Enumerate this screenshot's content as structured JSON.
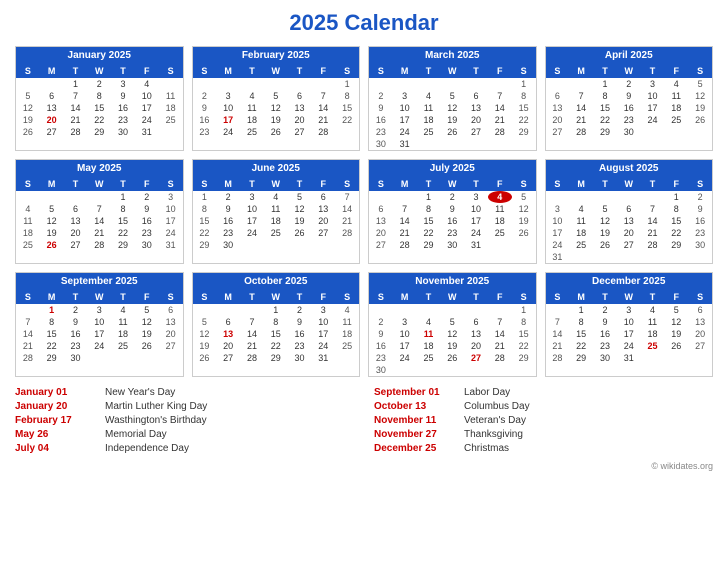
{
  "title": "2025 Calendar",
  "months": [
    {
      "name": "January 2025",
      "weeks": [
        [
          "",
          "",
          "1",
          "2",
          "3",
          "4",
          ""
        ],
        [
          "5",
          "6",
          "7",
          "8",
          "9",
          "10",
          "11"
        ],
        [
          "12",
          "13",
          "14",
          "15",
          "16",
          "17",
          "18"
        ],
        [
          "19",
          "20h",
          "21",
          "22",
          "23",
          "24",
          "25"
        ],
        [
          "26",
          "27",
          "28",
          "29",
          "30",
          "31",
          ""
        ]
      ]
    },
    {
      "name": "February 2025",
      "weeks": [
        [
          "",
          "",
          "",
          "",
          "",
          "",
          "1"
        ],
        [
          "2",
          "3",
          "4",
          "5",
          "6",
          "7",
          "8"
        ],
        [
          "9",
          "10",
          "11",
          "12",
          "13",
          "14",
          "15"
        ],
        [
          "16",
          "17h",
          "18",
          "19",
          "20",
          "21",
          "22"
        ],
        [
          "23",
          "24",
          "25",
          "26",
          "27",
          "28",
          ""
        ]
      ]
    },
    {
      "name": "March 2025",
      "weeks": [
        [
          "",
          "",
          "",
          "",
          "",
          "",
          "1"
        ],
        [
          "2",
          "3",
          "4",
          "5",
          "6",
          "7",
          "8"
        ],
        [
          "9",
          "10",
          "11",
          "12",
          "13",
          "14",
          "15"
        ],
        [
          "16",
          "17",
          "18",
          "19",
          "20",
          "21",
          "22"
        ],
        [
          "23",
          "24",
          "25",
          "26",
          "27",
          "28",
          "29"
        ],
        [
          "30",
          "31",
          "",
          "",
          "",
          "",
          ""
        ]
      ]
    },
    {
      "name": "April 2025",
      "weeks": [
        [
          "",
          "",
          "1",
          "2",
          "3",
          "4",
          "5"
        ],
        [
          "6",
          "7",
          "8",
          "9",
          "10",
          "11",
          "12"
        ],
        [
          "13",
          "14",
          "15",
          "16",
          "17",
          "18",
          "19"
        ],
        [
          "20",
          "21",
          "22",
          "23",
          "24",
          "25",
          "26"
        ],
        [
          "27",
          "28",
          "29",
          "30",
          "",
          "",
          ""
        ]
      ]
    },
    {
      "name": "May 2025",
      "weeks": [
        [
          "",
          "",
          "",
          "",
          "1",
          "2",
          "3"
        ],
        [
          "4",
          "5",
          "6",
          "7",
          "8",
          "9",
          "10"
        ],
        [
          "11",
          "12",
          "13",
          "14",
          "15",
          "16",
          "17"
        ],
        [
          "18",
          "19",
          "20",
          "21",
          "22",
          "23",
          "24"
        ],
        [
          "25",
          "26h",
          "27",
          "28",
          "29",
          "30",
          "31"
        ]
      ]
    },
    {
      "name": "June 2025",
      "weeks": [
        [
          "1",
          "2",
          "3",
          "4",
          "5",
          "6",
          "7"
        ],
        [
          "8",
          "9",
          "10",
          "11",
          "12",
          "13",
          "14"
        ],
        [
          "15",
          "16",
          "17",
          "18",
          "19",
          "20",
          "21"
        ],
        [
          "22",
          "23",
          "24",
          "25",
          "26",
          "27",
          "28"
        ],
        [
          "29",
          "30",
          "",
          "",
          "",
          "",
          ""
        ]
      ]
    },
    {
      "name": "July 2025",
      "weeks": [
        [
          "",
          "",
          "1",
          "2",
          "3",
          "4r",
          "5"
        ],
        [
          "6",
          "7",
          "8",
          "9",
          "10",
          "11",
          "12"
        ],
        [
          "13",
          "14",
          "15",
          "16",
          "17",
          "18",
          "19"
        ],
        [
          "20",
          "21",
          "22",
          "23",
          "24",
          "25",
          "26"
        ],
        [
          "27",
          "28",
          "29",
          "30",
          "31",
          "",
          ""
        ]
      ]
    },
    {
      "name": "August 2025",
      "weeks": [
        [
          "",
          "",
          "",
          "",
          "",
          "1",
          "2"
        ],
        [
          "3",
          "4",
          "5",
          "6",
          "7",
          "8",
          "9"
        ],
        [
          "10",
          "11",
          "12",
          "13",
          "14",
          "15",
          "16"
        ],
        [
          "17",
          "18",
          "19",
          "20",
          "21",
          "22",
          "23"
        ],
        [
          "24",
          "25",
          "26",
          "27",
          "28",
          "29",
          "30"
        ],
        [
          "31",
          "",
          "",
          "",
          "",
          "",
          ""
        ]
      ]
    },
    {
      "name": "September 2025",
      "weeks": [
        [
          "",
          "1h",
          "2",
          "3",
          "4",
          "5",
          "6"
        ],
        [
          "7",
          "8",
          "9",
          "10",
          "11",
          "12",
          "13"
        ],
        [
          "14",
          "15",
          "16",
          "17",
          "18",
          "19",
          "20"
        ],
        [
          "21",
          "22",
          "23",
          "24",
          "25",
          "26",
          "27"
        ],
        [
          "28",
          "29",
          "30",
          "",
          "",
          "",
          ""
        ]
      ]
    },
    {
      "name": "October 2025",
      "weeks": [
        [
          "",
          "",
          "",
          "1",
          "2",
          "3",
          "4"
        ],
        [
          "5",
          "6",
          "7",
          "8",
          "9",
          "10",
          "11"
        ],
        [
          "12",
          "13h",
          "14",
          "15",
          "16",
          "17",
          "18"
        ],
        [
          "19",
          "20",
          "21",
          "22",
          "23",
          "24",
          "25"
        ],
        [
          "26",
          "27",
          "28",
          "29",
          "30",
          "31",
          ""
        ]
      ]
    },
    {
      "name": "November 2025",
      "weeks": [
        [
          "",
          "",
          "",
          "",
          "",
          "",
          "1"
        ],
        [
          "2",
          "3",
          "4",
          "5",
          "6",
          "7",
          "8"
        ],
        [
          "9",
          "10",
          "11h",
          "12",
          "13",
          "14",
          "15"
        ],
        [
          "16",
          "17",
          "18",
          "19",
          "20",
          "21",
          "22"
        ],
        [
          "23",
          "24",
          "25",
          "26",
          "27h",
          "28",
          "29"
        ],
        [
          "30",
          "",
          "",
          "",
          "",
          "",
          ""
        ]
      ]
    },
    {
      "name": "December 2025",
      "weeks": [
        [
          "",
          "1",
          "2",
          "3",
          "4",
          "5",
          "6"
        ],
        [
          "7",
          "8",
          "9",
          "10",
          "11",
          "12",
          "13"
        ],
        [
          "14",
          "15",
          "16",
          "17",
          "18",
          "19",
          "20"
        ],
        [
          "21",
          "22",
          "23",
          "24",
          "25h",
          "26",
          "27"
        ],
        [
          "28",
          "29",
          "30",
          "31",
          "",
          "",
          ""
        ]
      ]
    }
  ],
  "dayHeaders": [
    "S",
    "M",
    "T",
    "W",
    "T",
    "F",
    "S"
  ],
  "holidays_left": [
    {
      "date": "January 01",
      "name": "New Year's Day"
    },
    {
      "date": "January 20",
      "name": "Martin Luther King Day"
    },
    {
      "date": "February 17",
      "name": "Wasthington's Birthday"
    },
    {
      "date": "May 26",
      "name": "Memorial Day"
    },
    {
      "date": "July 04",
      "name": "Independence Day"
    }
  ],
  "holidays_right": [
    {
      "date": "September 01",
      "name": "Labor Day"
    },
    {
      "date": "October 13",
      "name": "Columbus Day"
    },
    {
      "date": "November 11",
      "name": "Veteran's Day"
    },
    {
      "date": "November 27",
      "name": "Thanksgiving"
    },
    {
      "date": "December 25",
      "name": "Christmas"
    }
  ],
  "wikidates": "© wikidates.org"
}
